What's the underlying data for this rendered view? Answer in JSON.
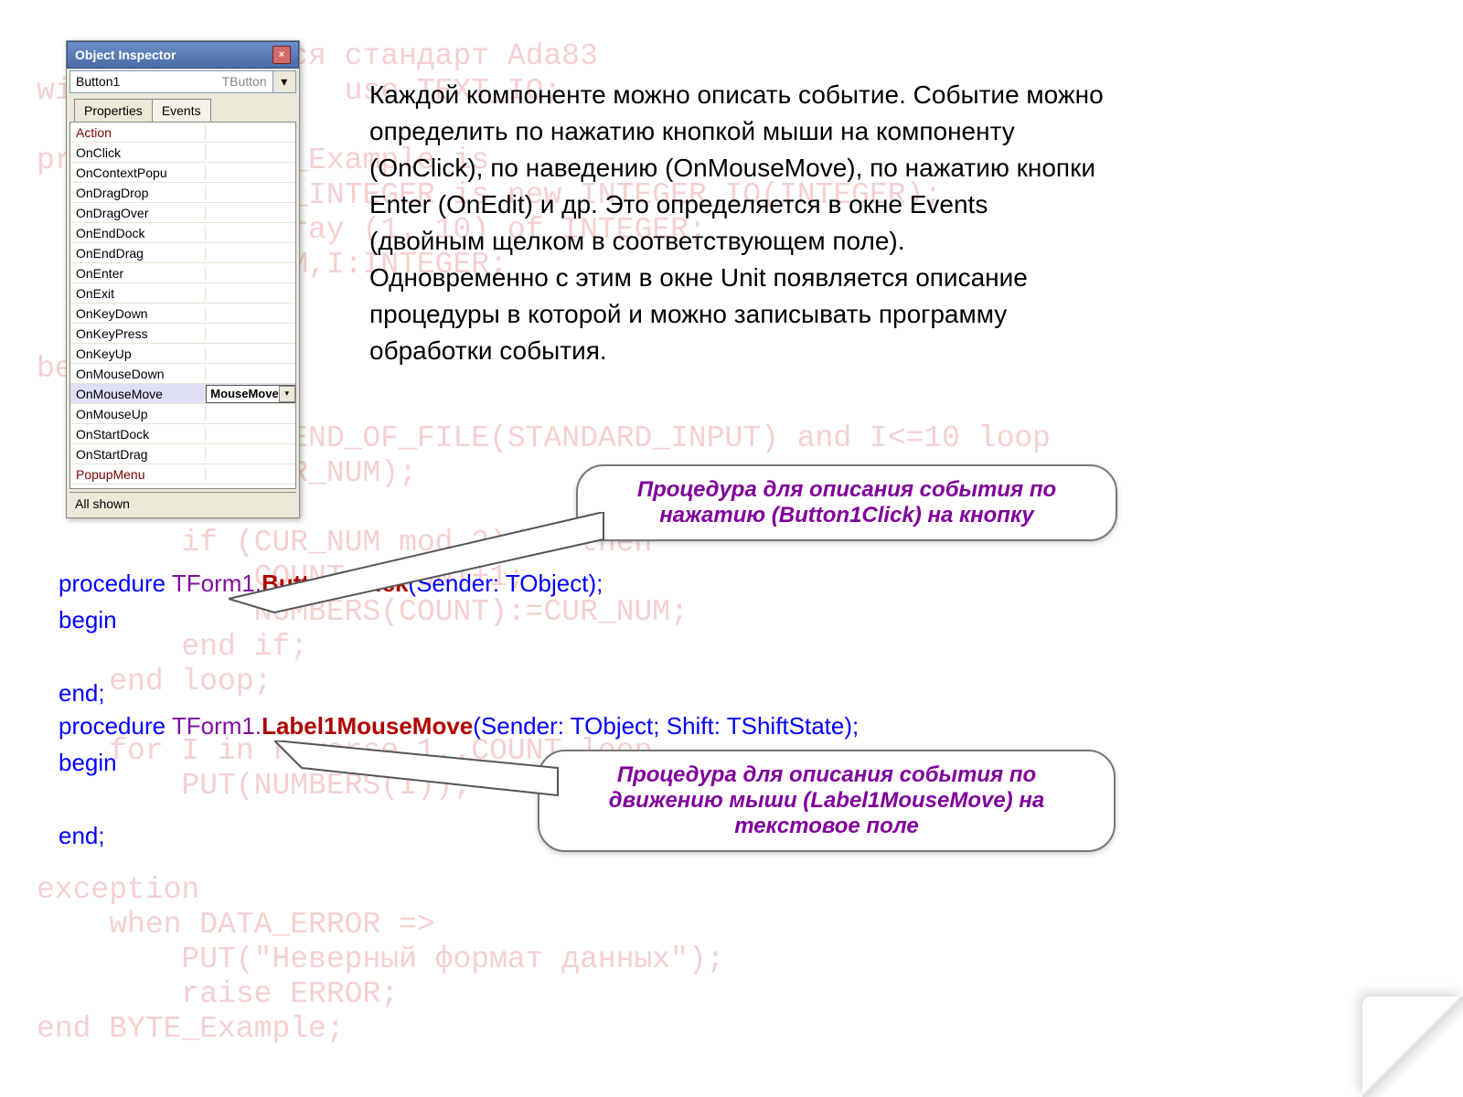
{
  "bg_code": "    Используется стандарт Ada83\nwith TEXT_IO;    use TEXT_IO;\n\nprocedure BYTE_Example is\n    type SMALL_INTEGER is new INTEGER_IO(INTEGER);\n    CUR_NUM:array (1..10) of INTEGER;\n    NUMBERS:NUM,I:INTEGER;\n\n    exception;\nbegin\n\n    while not END_OF_FILE(STANDARD_INPUT) and I<=10 loop\n        GET(CUR_NUM);\n\n        if (CUR_NUM mod 2)/=0 then\n            COUNT:=COUNT+1;\n            NUMBERS(COUNT):=CUR_NUM;\n        end if;\n    end loop;\n\n    for I in reverse 1..COUNT loop\n        PUT(NUMBERS(I));\n\n\nexception\n    when DATA_ERROR =>\n        PUT(\"Неверный формат данных\");\n        raise ERROR;\nend BYTE_Example;",
  "inspector": {
    "title": "Object Inspector",
    "object": "Button1",
    "objtype": "TButton",
    "tabs": {
      "properties": "Properties",
      "events": "Events"
    },
    "rows": [
      {
        "k": "Action",
        "maroon": true
      },
      {
        "k": "OnClick"
      },
      {
        "k": "OnContextPopu"
      },
      {
        "k": "OnDragDrop"
      },
      {
        "k": "OnDragOver"
      },
      {
        "k": "OnEndDock"
      },
      {
        "k": "OnEndDrag"
      },
      {
        "k": "OnEnter"
      },
      {
        "k": "OnExit"
      },
      {
        "k": "OnKeyDown"
      },
      {
        "k": "OnKeyPress"
      },
      {
        "k": "OnKeyUp"
      },
      {
        "k": "OnMouseDown"
      },
      {
        "k": "OnMouseMove",
        "sel": true,
        "v": "MouseMove"
      },
      {
        "k": "OnMouseUp"
      },
      {
        "k": "OnStartDock"
      },
      {
        "k": "OnStartDrag"
      },
      {
        "k": "PopupMenu",
        "maroon": true
      }
    ],
    "status": "All shown"
  },
  "paragraph": "Каждой компоненте можно описать событие. Событие можно определить по нажатию кнопкой мыши на компоненту (OnClick), по наведению (OnMouseMove), по нажатию кнопки Enter (OnEdit) и др. Это определяется в окне Events (двойным щелком в соответствующем поле).\nОдновременно с этим в окне Unit появляется описание процедуры в которой и можно записывать программу обработки события.",
  "callout1": "Процедура для описания события по нажатию  (Button1Click) на кнопку",
  "callout2": "Процедура для описания события по движению мыши  (Label1MouseMove) на текстовое поле",
  "code1": {
    "p": "procedure ",
    "f": "TForm1.",
    "m": "Button1Click",
    "a": "(Sender: TObject);",
    "b": "begin",
    "e": "end;"
  },
  "code2": {
    "p": "procedure ",
    "f": "TForm1.",
    "m": "Label1MouseMove",
    "a": "(Sender: TObject; Shift: TShiftState);",
    "b": "begin",
    "e": "end;"
  }
}
